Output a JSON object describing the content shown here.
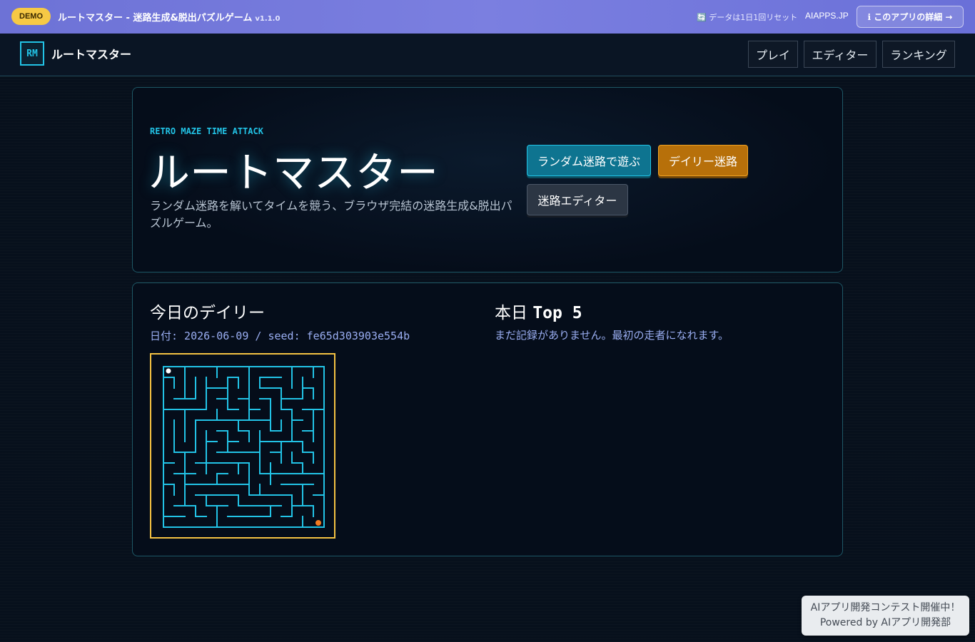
{
  "demo_bar": {
    "badge": "DEMO",
    "title": "ルートマスター - 迷路生成&脱出パズルゲーム",
    "version": "v1.1.0",
    "reset_note": "🔄 データは1日1回リセット",
    "site": "AIAPPS.JP",
    "detail_button": "ℹ このアプリの詳細 →"
  },
  "header": {
    "logo": "RM",
    "app_name": "ルートマスター",
    "nav": [
      "プレイ",
      "エディター",
      "ランキング"
    ]
  },
  "hero": {
    "tagline": "RETRO MAZE TIME ATTACK",
    "title": "ルートマスター",
    "description": "ランダム迷路を解いてタイムを競う、ブラウザ完結の迷路生成&脱出パズルゲーム。",
    "buttons": {
      "random": "ランダム迷路で遊ぶ",
      "daily": "デイリー迷路",
      "editor": "迷路エディター"
    }
  },
  "daily": {
    "title": "今日のデイリー",
    "meta": "日付: 2026-06-09 / seed: fe65d303903e554b",
    "maze": {
      "wall_color": "#22c3e6",
      "start_color": "#ffffff",
      "goal_color": "#f47a1f",
      "size": 15
    }
  },
  "ranking": {
    "title_prefix": "本日",
    "title_suffix": "Top 5",
    "empty": "まだ記録がありません。最初の走者になれます。"
  },
  "contest": {
    "line1": "AIアプリ開発コンテスト開催中！",
    "line2": "Powered by AIアプリ開発部"
  },
  "colors": {
    "accent": "#22c3e6",
    "daily": "#b7700a",
    "demo_bar": "#7b7fe0"
  }
}
